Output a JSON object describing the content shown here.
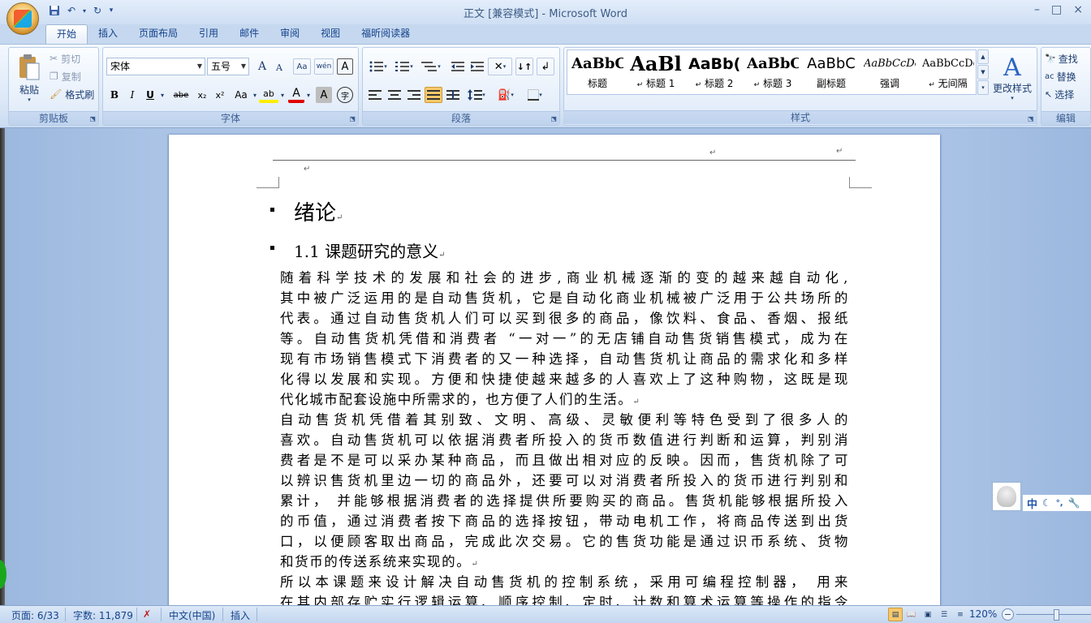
{
  "window": {
    "title": "正文 [兼容模式] - Microsoft Word",
    "controls": [
      "–",
      "□",
      "×"
    ]
  },
  "qat": {
    "save_icon": "save-icon",
    "undo_icon": "undo-icon",
    "redo_icon": "redo-icon",
    "customize": "▾"
  },
  "tabs": [
    "开始",
    "插入",
    "页面布局",
    "引用",
    "邮件",
    "审阅",
    "视图",
    "福昕阅读器"
  ],
  "ribbon": {
    "clipboard": {
      "label": "剪贴板",
      "paste": "粘贴",
      "cut": "剪切",
      "copy": "复制",
      "format_painter": "格式刷"
    },
    "font": {
      "label": "字体",
      "font_name": "宋体",
      "font_size": "五号",
      "grow": "A",
      "shrink": "A",
      "clear": "Aa",
      "phonetic": "wén",
      "border": "A",
      "bold": "B",
      "italic": "I",
      "underline": "U",
      "strike": "abe",
      "subscript": "x₂",
      "superscript": "x²",
      "change_case": "Aa",
      "highlight": "ab",
      "font_color": "A",
      "char_shading": "A",
      "enclose": "字"
    },
    "paragraph": {
      "label": "段落"
    },
    "styles": {
      "label": "样式",
      "items": [
        {
          "sample": "AaBbC",
          "name": "标题"
        },
        {
          "sample": "AaBl",
          "name": "标题 1"
        },
        {
          "sample": "AaBb(",
          "name": "标题 2"
        },
        {
          "sample": "AaBbC",
          "name": "标题 3"
        },
        {
          "sample": "AaBbC",
          "name": "副标题"
        },
        {
          "sample": "AaBbCcDc",
          "name": "强调"
        },
        {
          "sample": "AaBbCcDc",
          "name": "无间隔"
        }
      ],
      "change_styles": "更改样式"
    },
    "editing": {
      "label": "编辑",
      "find": "查找",
      "replace": "替换",
      "select": "选择"
    }
  },
  "document": {
    "heading1": "绪论",
    "heading2": "1.1  课题研究的意义",
    "lines": [
      "    随着科学技术的发展和社会的进步,商业机械逐渐的变的越来越自动化,",
      "其中被广泛运用的是自动售货机，它是自动化商业机械被广泛用于公共场所的",
      "代表。通过自动售货机人们可以买到很多的商品，像饮料、食品、香烟、报纸",
      "等。自动售货机凭借和消费者 “一对一”的无店铺自动售货销售模式，成为在",
      "现有市场销售模式下消费者的又一种选择，自动售货机让商品的需求化和多样",
      "化得以发展和实现。方便和快捷使越来越多的人喜欢上了这种购物，这既是现",
      "代化城市配套设施中所需求的，也方便了人们的生活。",
      "    自动售货机凭借着其别致、文明、高级、灵敏便利等特色受到了很多人的",
      "喜欢。自动售货机可以依据消费者所投入的货币数值进行判断和运算，判别消",
      "费者是不是可以采办某种商品，而且做出相对应的反映。因而，售货机除了可",
      "以辨识售货机里边一切的商品外，还要可以对消费者所投入的货币进行判别和",
      "累计，  并能够根据消费者的选择提供所要购买的商品。售货机能够根据所投入",
      "的币值，通过消费者按下商品的选择按钮，带动电机工作，将商品传送到出货",
      "口，以便顾客取出商品，完成此次交易。它的售货功能是通过识币系统、货物",
      "和货币的传送系统来实现的。",
      "    所以本课题来设计解决自动售货机的控制系统，采用可编程控制器， 用来",
      "在其内部存贮实行逻辑运算、顺序控制、定时、计数和算术运算等操作的指令"
    ]
  },
  "statusbar": {
    "page": "页面: 6/33",
    "words": "字数: 11,879",
    "language": "中文(中国)",
    "mode": "插入",
    "zoom": "120%"
  },
  "ime": {
    "label": "中"
  }
}
